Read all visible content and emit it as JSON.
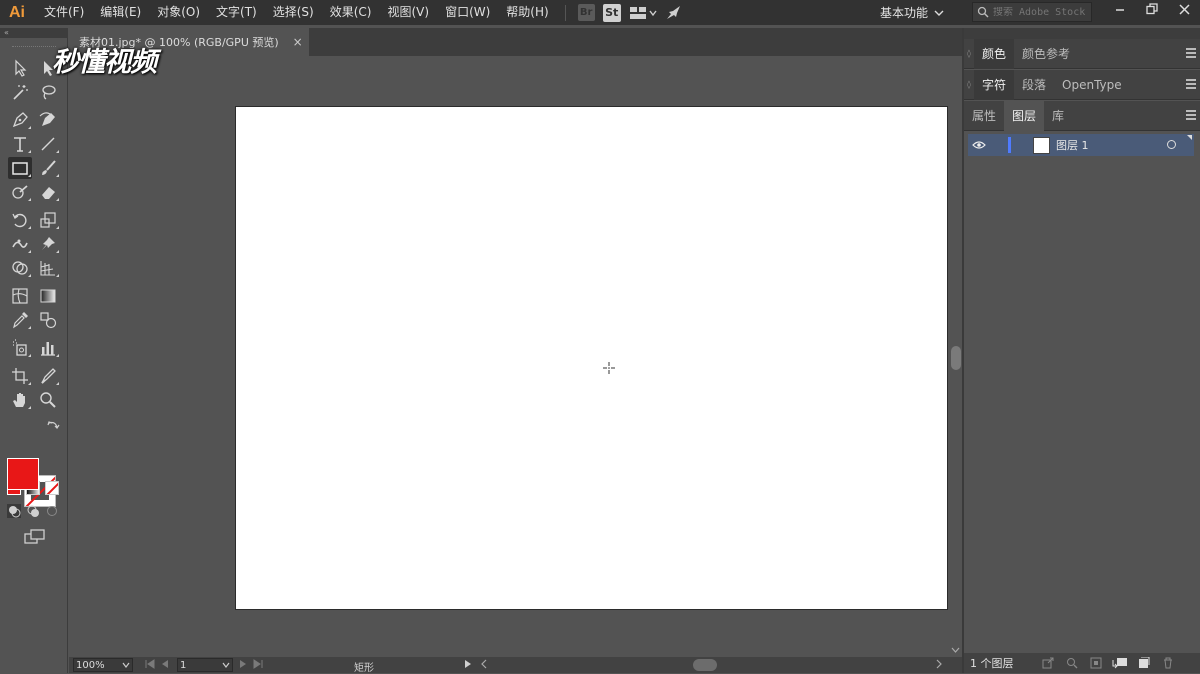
{
  "app": {
    "logo": "Ai"
  },
  "menu": [
    "文件(F)",
    "编辑(E)",
    "对象(O)",
    "文字(T)",
    "选择(S)",
    "效果(C)",
    "视图(V)",
    "窗口(W)",
    "帮助(H)"
  ],
  "menubar_badges": {
    "br": "Br",
    "st": "St"
  },
  "workspace": {
    "label": "基本功能"
  },
  "search": {
    "placeholder": "搜索 Adobe Stock"
  },
  "document": {
    "tab_title": "素材01.jpg* @ 100% (RGB/GPU 预览)",
    "close_glyph": "×"
  },
  "watermark": {
    "text": "秒懂视频"
  },
  "status": {
    "zoom": "100%",
    "artboard_number": "1",
    "tool_name": "矩形"
  },
  "panels": {
    "row1": [
      "颜色",
      "颜色参考"
    ],
    "row2": [
      "字符",
      "段落",
      "OpenType"
    ],
    "row3": [
      "属性",
      "图层",
      "库"
    ],
    "layers": [
      {
        "name": "图层 1",
        "visible": true,
        "color": "#4f7bff"
      }
    ],
    "footer_count": "1 个图层"
  },
  "colors": {
    "fill": "#e81717",
    "stroke": "#ffffff",
    "accent": "#4a5b78"
  },
  "tools": [
    "selection-tool",
    "direct-selection-tool",
    "magic-wand-tool",
    "lasso-tool",
    "pen-tool",
    "curvature-tool",
    "type-tool",
    "line-segment-tool",
    "rectangle-tool",
    "paintbrush-tool",
    "shaper-tool",
    "eraser-tool",
    "rotate-tool",
    "scale-tool",
    "width-tool",
    "puppet-warp-tool",
    "shape-builder-tool",
    "perspective-grid-tool",
    "mesh-tool",
    "gradient-tool",
    "eyedropper-tool",
    "blend-tool",
    "symbol-sprayer-tool",
    "column-graph-tool",
    "artboard-tool",
    "slice-tool",
    "hand-tool",
    "zoom-tool"
  ]
}
